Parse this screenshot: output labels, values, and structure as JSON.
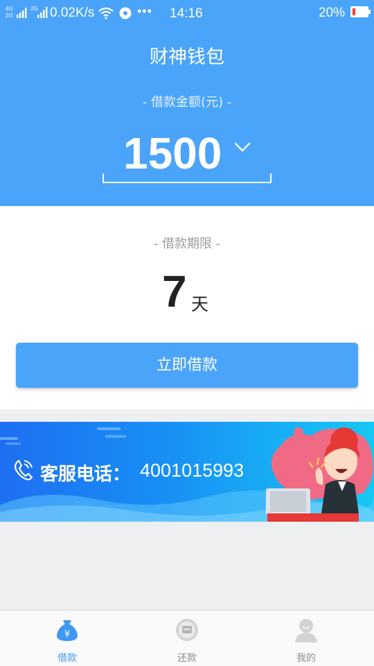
{
  "status_bar": {
    "net_speed": "0.02K/s",
    "time": "14:16",
    "battery": "20%",
    "battery_level": 0.2,
    "signal_labels": [
      "4G",
      "2G",
      "2G"
    ],
    "icons": [
      "signal-icon",
      "wifi-icon",
      "disc-icon",
      "more-dots-icon",
      "battery-icon"
    ]
  },
  "header": {
    "title": "财神钱包",
    "amount_label": "- 借款金额(元) -",
    "amount": "1500"
  },
  "term": {
    "label": "- 借款期限 -",
    "value": "7",
    "unit": "天"
  },
  "actions": {
    "borrow_button": "立即借款"
  },
  "banner": {
    "label": "客服电话：",
    "phone": "4001015993"
  },
  "bottom_nav": {
    "items": [
      {
        "label": "借款",
        "icon": "money-bag-icon",
        "active": true
      },
      {
        "label": "还款",
        "icon": "wallet-icon",
        "active": false
      },
      {
        "label": "我的",
        "icon": "user-icon",
        "active": false
      }
    ]
  },
  "colors": {
    "primary": "#4aa4f9",
    "background": "#eeeff1",
    "battery_low": "#ff3b30"
  }
}
